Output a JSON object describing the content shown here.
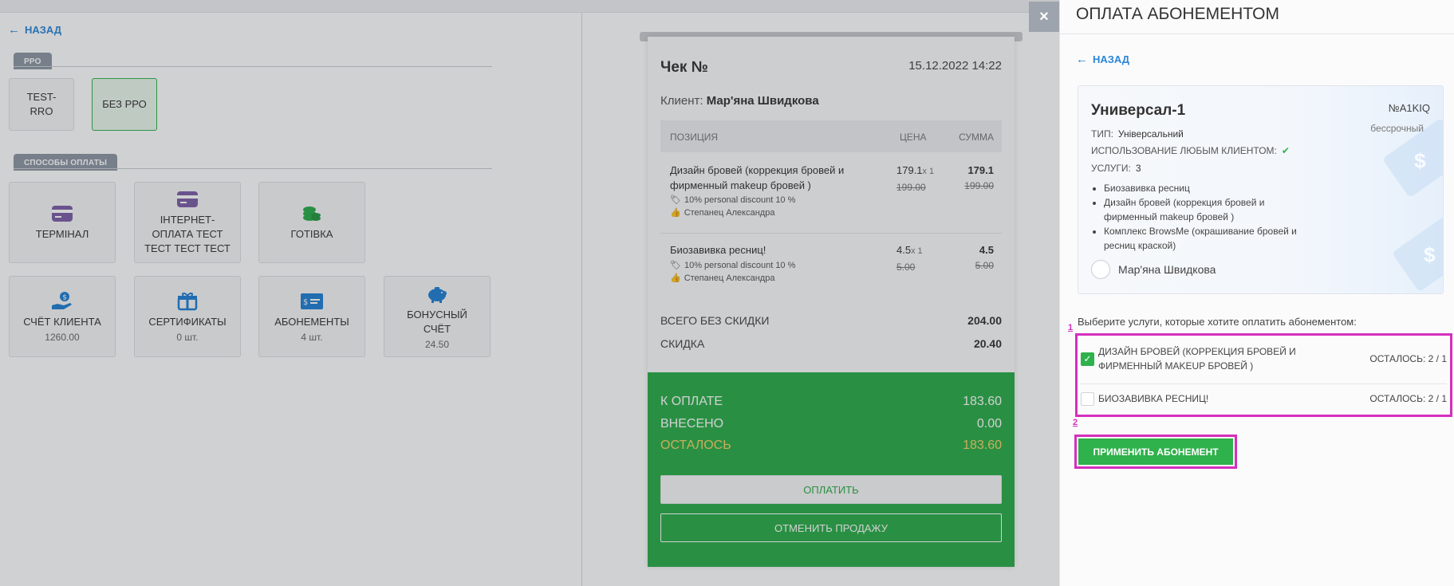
{
  "left": {
    "back_label": "НАЗАД",
    "rro_section": "РРО",
    "rro_options": [
      {
        "label": "TEST-RRO",
        "active": false
      },
      {
        "label": "БЕЗ РРО",
        "active": true
      }
    ],
    "payments_section": "СПОСОБЫ ОПЛАТЫ",
    "payment_methods": [
      {
        "label": "ТЕРМІНАЛ",
        "sub": "",
        "icon": "card-icon"
      },
      {
        "label": "ІНТЕРНЕТ-ОПЛАТА ТЕСТ ТЕСТ ТЕСТ ТЕСТ",
        "sub": "",
        "icon": "card-icon"
      },
      {
        "label": "ГОТІВКА",
        "sub": "",
        "icon": "coins-icon"
      },
      {
        "label": "СЧЁТ КЛИЕНТА",
        "sub": "1260.00",
        "icon": "hand-money-icon"
      },
      {
        "label": "СЕРТИФИКАТЫ",
        "sub": "0 шт.",
        "icon": "gift-icon"
      },
      {
        "label": "АБОНЕМЕНТЫ",
        "sub": "4 шт.",
        "icon": "subscription-card-icon"
      },
      {
        "label": "БОНУСНЫЙ СЧЁТ",
        "sub": "24.50",
        "icon": "piggy-bank-icon"
      }
    ]
  },
  "receipt": {
    "title": "Чек №",
    "date": "15.12.2022 14:22",
    "client_label": "Клиент:",
    "client_name": "Мар'яна Швидкова",
    "columns": [
      "ПОЗИЦИЯ",
      "ЦЕНА",
      "СУММА"
    ],
    "items": [
      {
        "name": "Дизайн бровей (коррекция бровей и фирменный makeup бровей )",
        "discount": "10% personal discount 10 %",
        "master": "Степанец Александра",
        "price": "179.1",
        "qty": "x 1",
        "old_price": "199.00",
        "sum": "179.1",
        "old_sum": "199.00"
      },
      {
        "name": "Биозавивка ресниц!",
        "discount": "10% personal discount 10 %",
        "master": "Степанец Александра",
        "price": "4.5",
        "qty": "x 1",
        "old_price": "5.00",
        "sum": "4.5",
        "old_sum": "5.00"
      }
    ],
    "total_no_discount_label": "ВСЕГО БЕЗ СКИДКИ",
    "total_no_discount": "204.00",
    "discount_label": "СКИДКА",
    "discount": "20.40",
    "to_pay_label": "К ОПЛАТЕ",
    "to_pay": "183.60",
    "paid_label": "ВНЕСЕНО",
    "paid": "0.00",
    "rest_label": "ОСТАЛОСЬ",
    "rest": "183.60",
    "pay_button": "ОПЛАТИТЬ",
    "cancel_button": "ОТМЕНИТЬ ПРОДАЖУ"
  },
  "panel": {
    "close": "×",
    "title": "ОПЛАТА АБОНЕМЕНТОМ",
    "back_label": "НАЗАД",
    "card": {
      "name": "Универсал-1",
      "number": "№A1KIQ",
      "validity": "бессрочный",
      "type_label": "ТИП:",
      "type_value": "Універсальний",
      "any_client_label": "ИСПОЛЬЗОВАНИЕ ЛЮБЫМ КЛИЕНТОМ:",
      "services_label": "УСЛУГИ:",
      "services_count": "3",
      "services": [
        "Биозавивка ресниц",
        "Дизайн бровей (коррекция бровей и фирменный makeup бровей )",
        "Комплекс BrowsMe (окрашивание бровей и ресниц краской)"
      ],
      "client": "Мар'яна Швидкова"
    },
    "hint": "Выберите услуги, которые хотите оплатить абонементом:",
    "marker_1": "1",
    "marker_2": "2",
    "services_select": [
      {
        "name": "ДИЗАЙН БРОВЕЙ (КОРРЕКЦИЯ БРОВЕЙ И ФИРМЕННЫЙ MAKEUP БРОВЕЙ )",
        "left": "ОСТАЛОСЬ: 2 / 1",
        "checked": true
      },
      {
        "name": "БИОЗАВИВКА РЕСНИЦ!",
        "left": "ОСТАЛОСЬ: 2 / 1",
        "checked": false
      }
    ],
    "apply_button": "ПРИМЕНИТЬ АБОНЕМЕНТ"
  },
  "colors": {
    "accent_green": "#2fb14b",
    "link_blue": "#2a86d6",
    "annotation_magenta": "#d42fbd",
    "icon_purple": "#7b5ea7",
    "icon_blue": "#1f7fd4"
  }
}
